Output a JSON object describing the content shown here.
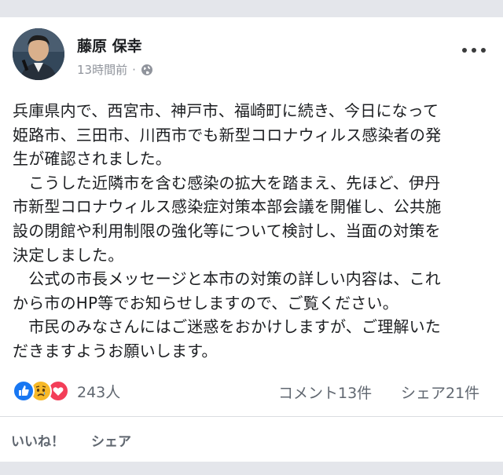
{
  "post": {
    "author": "藤原 保幸",
    "time": "13時間前",
    "dot_separator": "·",
    "body_lines": [
      "兵庫県内で、西宮市、神戸市、福崎町に続き、今日になって",
      "姫路市、三田市、川西市でも新型コロナウィルス感染者の発",
      "生が確認されました。",
      "　こうした近隣市を含む感染の拡大を踏まえ、先ほど、伊丹",
      "市新型コロナウィルス感染症対策本部会議を開催し、公共施",
      "設の閉館や利用制限の強化等について検討し、当面の対策を",
      "決定しました。",
      "　公式の市長メッセージと本市の対策の詳しい内容は、これ",
      "から市のHP等でお知らせしますので、ご覧ください。",
      "　市民のみなさんにはご迷惑をおかけしますが、ご理解いた",
      "だきますようお願いします。"
    ]
  },
  "stats": {
    "reaction_count": "243人",
    "comments": "コメント13件",
    "shares": "シェア21件"
  },
  "actions": {
    "like": "いいね！",
    "share": "シェア"
  },
  "icons": {
    "globe": "globe-icon",
    "more": "more-options-icon",
    "like_reaction": "like-reaction-icon",
    "sad_reaction": "sad-reaction-icon",
    "love_reaction": "love-reaction-icon"
  },
  "colors": {
    "like_blue": "#1877f2",
    "sad_yellow": "#f7b928",
    "love_red": "#f33e58",
    "text": "#1c1e21",
    "muted": "#606770"
  }
}
